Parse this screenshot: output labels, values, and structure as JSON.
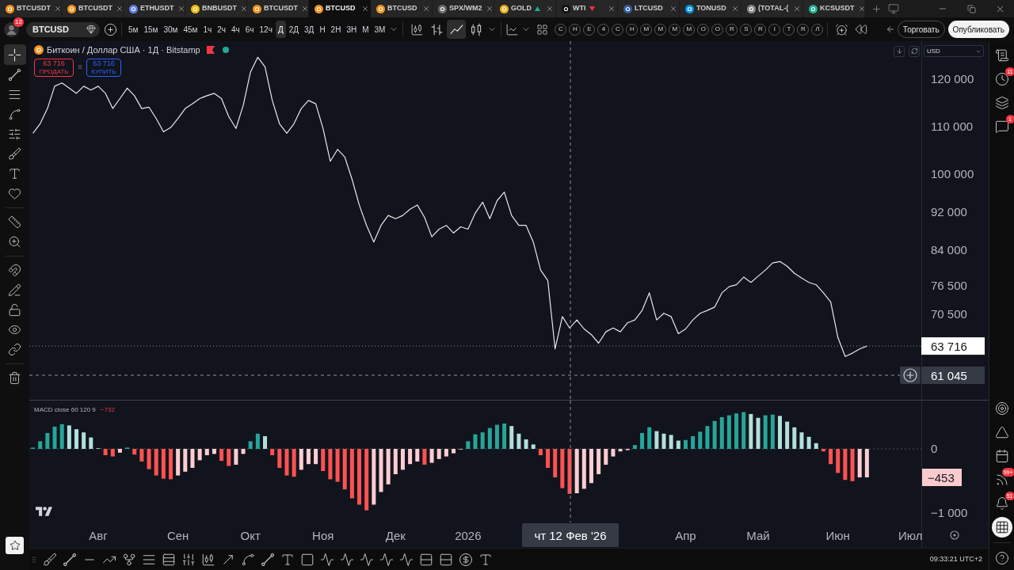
{
  "tabs": [
    {
      "label": "BTCUSDT",
      "selected": false,
      "color": "#f7931a",
      "up": false,
      "down": false
    },
    {
      "label": "BTCUSDT",
      "selected": false,
      "color": "#f7931a",
      "up": false,
      "down": false
    },
    {
      "label": "ETHUSDT",
      "selected": false,
      "color": "#627eea",
      "up": false,
      "down": false
    },
    {
      "label": "BNBUSDT",
      "selected": false,
      "color": "#f0b90b",
      "up": false,
      "down": false
    },
    {
      "label": "BTCUSDT",
      "selected": false,
      "color": "#f7931a",
      "up": false,
      "down": false
    },
    {
      "label": "BTCUSD",
      "selected": true,
      "color": "#f7931a",
      "up": false,
      "down": false
    },
    {
      "label": "BTCUSD",
      "selected": false,
      "color": "#f7931a",
      "up": false,
      "down": false
    },
    {
      "label": "SPX/WM2",
      "selected": false,
      "color": "#6b6b6b",
      "up": false,
      "down": false
    },
    {
      "label": "GOLD",
      "selected": false,
      "color": "#e8b123",
      "up": true,
      "down": false
    },
    {
      "label": "WTI",
      "selected": false,
      "color": "#111111",
      "up": false,
      "down": true
    },
    {
      "label": "LTCUSD",
      "selected": false,
      "color": "#345d9d",
      "up": false,
      "down": false
    },
    {
      "label": "TONUSD",
      "selected": false,
      "color": "#0098ea",
      "up": false,
      "down": false
    },
    {
      "label": "(TOTAL-(",
      "selected": false,
      "color": "#8a8a8a",
      "up": false,
      "down": false
    },
    {
      "label": "KCSUSDT",
      "selected": false,
      "color": "#23af91",
      "up": false,
      "down": false
    }
  ],
  "toolbar": {
    "avatar_badge": "12",
    "symbol": "BTCUSD",
    "intervals": [
      {
        "label": "5м",
        "selected": false
      },
      {
        "label": "15м",
        "selected": false
      },
      {
        "label": "30м",
        "selected": false
      },
      {
        "label": "45м",
        "selected": false
      },
      {
        "label": "1ч",
        "selected": false
      },
      {
        "label": "2ч",
        "selected": false
      },
      {
        "label": "4ч",
        "selected": false
      },
      {
        "label": "6ч",
        "selected": false
      },
      {
        "label": "12ч",
        "selected": false
      },
      {
        "label": "Д",
        "selected": true
      },
      {
        "label": "2Д",
        "selected": false
      },
      {
        "label": "3Д",
        "selected": false
      },
      {
        "label": "Н",
        "selected": false
      },
      {
        "label": "2Н",
        "selected": false
      },
      {
        "label": "3Н",
        "selected": false
      },
      {
        "label": "М",
        "selected": false
      },
      {
        "label": "3М",
        "selected": false
      }
    ],
    "chart_types": [
      {
        "selected": false
      },
      {
        "selected": false
      },
      {
        "selected": true
      },
      {
        "selected": false
      }
    ],
    "favorite_indicators": [
      "C",
      "H",
      "E",
      "4",
      "C",
      "H",
      "M",
      "M",
      "M",
      "M",
      "O",
      "O",
      "R",
      "S",
      "R",
      "I",
      "T",
      "R",
      "Л"
    ],
    "trade_button": "Торговать",
    "publish_button": "Опубликовать"
  },
  "left_toolbar": {
    "tools": [
      {
        "selected": true
      },
      {
        "selected": false
      },
      {
        "selected": false
      },
      {
        "selected": false
      },
      {
        "selected": false
      },
      {
        "selected": false
      },
      {
        "selected": false
      },
      {
        "selected": false
      },
      {
        "selected": false
      },
      {
        "selected": false
      },
      {
        "selected": false
      },
      {
        "selected": false
      },
      {
        "selected": false
      },
      {
        "selected": false
      },
      {
        "selected": false
      },
      {
        "selected": false
      }
    ]
  },
  "chart": {
    "legend": {
      "title": "Биткоин / Доллар США · 1Д · Bitstamp",
      "sell": {
        "price": "63 716",
        "label": "ПРОДАТЬ"
      },
      "spread": "0",
      "buy": {
        "price": "63 716",
        "label": "КУПИТЬ"
      }
    },
    "currency": "USD",
    "chart_data": {
      "type": "line",
      "values": [
        108500,
        110500,
        113700,
        118400,
        119100,
        118000,
        116900,
        118400,
        117600,
        118400,
        116900,
        113700,
        115800,
        118000,
        116400,
        113700,
        114000,
        111600,
        108800,
        109700,
        111600,
        113700,
        114700,
        115800,
        116400,
        116900,
        115800,
        112000,
        109500,
        114400,
        121400,
        124500,
        122500,
        115400,
        110500,
        108500,
        110500,
        113700,
        115400,
        114700,
        109500,
        102600,
        105100,
        103500,
        98800,
        93400,
        89100,
        85600,
        89100,
        91200,
        90500,
        91200,
        92500,
        93400,
        90800,
        86700,
        88300,
        89100,
        87500,
        88800,
        88300,
        91700,
        94000,
        90500,
        94300,
        96100,
        91200,
        89100,
        89100,
        85600,
        79700,
        77500,
        63100,
        69900,
        67500,
        69200,
        67300,
        66100,
        64300,
        66700,
        67500,
        66700,
        68600,
        69200,
        71200,
        74900,
        69200,
        70600,
        69900,
        66300,
        67300,
        69200,
        70600,
        71200,
        71900,
        74900,
        76200,
        76600,
        78200,
        77100,
        78400,
        79700,
        81200,
        81500,
        80500,
        79000,
        78000,
        77100,
        76600,
        74900,
        73000,
        65500,
        61500,
        62200,
        63100,
        63700,
        null,
        null,
        null,
        null,
        null,
        null,
        null
      ],
      "ylim": [
        52380,
        127880
      ],
      "yticks": [
        {
          "value": 120000,
          "label": "120 000"
        },
        {
          "value": 110000,
          "label": "110 000"
        },
        {
          "value": 100000,
          "label": "100 000"
        },
        {
          "value": 92000,
          "label": "92 000"
        },
        {
          "value": 84000,
          "label": "84 000"
        },
        {
          "value": 76500,
          "label": "76 500"
        },
        {
          "value": 70500,
          "label": "70 500"
        }
      ],
      "ref_lines": [
        {
          "axis": "y",
          "value": 63700
        }
      ],
      "annotations": [
        "63 716",
        "61 045"
      ]
    },
    "indicator": {
      "legend": "MACD close 60 120 9",
      "value": "−732",
      "chart_data": {
        "type": "bar",
        "categories": [
          null,
          null,
          null,
          null,
          null,
          null,
          null,
          null,
          null,
          "Авг",
          null,
          null,
          null,
          null,
          null,
          null,
          null,
          null,
          null,
          null,
          "Сен",
          null,
          null,
          null,
          null,
          null,
          null,
          null,
          null,
          null,
          "Окт",
          null,
          null,
          null,
          null,
          null,
          null,
          null,
          null,
          null,
          "Ноя",
          null,
          null,
          null,
          null,
          null,
          null,
          null,
          null,
          null,
          "Дек",
          null,
          null,
          null,
          null,
          null,
          null,
          null,
          null,
          null,
          "2026",
          null,
          null,
          null,
          null,
          null,
          null,
          null,
          null,
          null,
          null,
          null,
          null,
          null,
          null,
          null,
          null,
          null,
          null,
          null,
          null,
          null,
          null,
          null,
          null,
          null,
          null,
          null,
          null,
          null,
          "Апр",
          null,
          null,
          null,
          null,
          null,
          null,
          null,
          null,
          null,
          "Май",
          null,
          null,
          null,
          null,
          null,
          null,
          null,
          null,
          null,
          null,
          "Июн",
          null,
          null,
          null,
          null,
          null,
          null,
          null,
          null,
          null,
          "Июл",
          null
        ],
        "values": [
          20,
          120,
          250,
          350,
          390,
          370,
          310,
          260,
          180,
          10,
          -100,
          -120,
          -60,
          20,
          -90,
          -200,
          -320,
          -420,
          -470,
          -480,
          -420,
          -360,
          -300,
          -180,
          -100,
          -80,
          -190,
          -270,
          -250,
          -80,
          120,
          240,
          200,
          -100,
          -300,
          -420,
          -440,
          -330,
          -240,
          -240,
          -350,
          -480,
          -520,
          -640,
          -780,
          -880,
          -970,
          -880,
          -680,
          -560,
          -400,
          -330,
          -240,
          -200,
          -250,
          -220,
          -160,
          -120,
          -70,
          -10,
          120,
          230,
          260,
          330,
          380,
          400,
          360,
          240,
          150,
          70,
          -100,
          -300,
          -450,
          -620,
          -710,
          -700,
          -630,
          -540,
          -400,
          -250,
          -120,
          -40,
          -20,
          60,
          250,
          340,
          280,
          240,
          220,
          130,
          140,
          200,
          270,
          360,
          440,
          500,
          530,
          560,
          580,
          550,
          490,
          530,
          540,
          520,
          430,
          340,
          260,
          190,
          90,
          -40,
          -240,
          -380,
          -490,
          -510,
          -450,
          -450,
          null,
          null,
          null,
          null,
          null,
          null,
          null
        ],
        "ylim": [
          -1162,
          762
        ],
        "yticks": [
          {
            "value": 0,
            "label": "0"
          },
          {
            "value": -1000,
            "label": "−1 000"
          }
        ],
        "ref_lines": [
          {
            "axis": "y",
            "value": 0
          }
        ],
        "annotations": [
          "−453",
          "чт 12 Фев '26"
        ]
      }
    }
  },
  "right_sidebar": {
    "items": [
      {
        "selected": false
      },
      {
        "selected": false,
        "badge": "11"
      },
      {
        "selected": false
      },
      {
        "selected": false,
        "badge": "1"
      },
      {
        "selected": false
      },
      {
        "selected": false
      },
      {
        "selected": false
      },
      {
        "selected": false,
        "badge": "99+"
      },
      {
        "selected": false,
        "badge": "51"
      },
      {
        "selected": true
      },
      {
        "selected": false
      }
    ]
  },
  "status_bar": {
    "time": "09:33:21 UTC+2"
  }
}
